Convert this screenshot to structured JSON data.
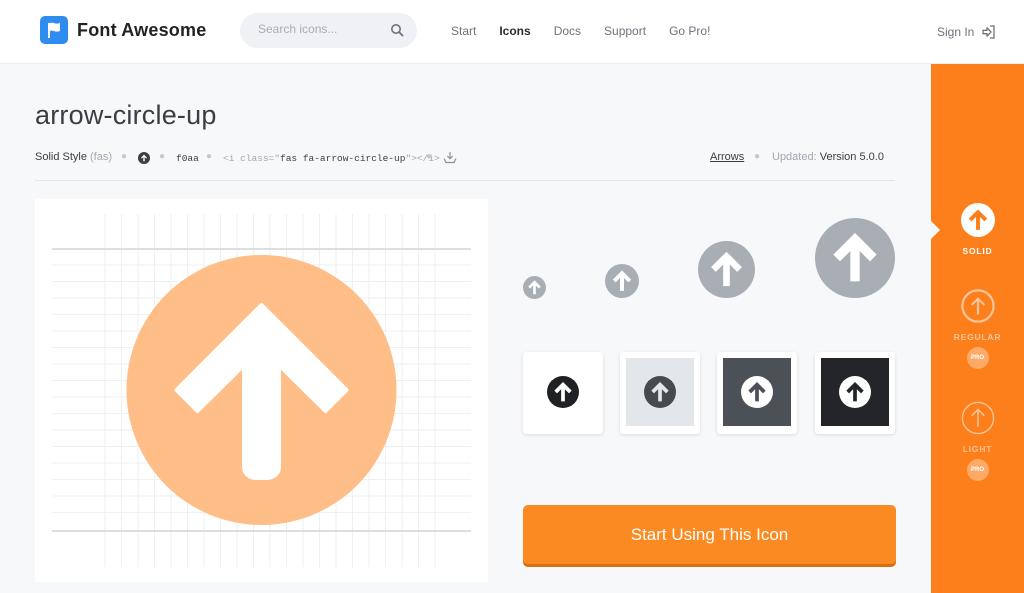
{
  "header": {
    "brand": "Font Awesome",
    "search_placeholder": "Search icons...",
    "nav": [
      "Start",
      "Icons",
      "Docs",
      "Support",
      "Go Pro!"
    ],
    "active_nav": "Icons",
    "sign_in": "Sign In"
  },
  "icon": {
    "name": "arrow-circle-up",
    "style_label": "Solid Style",
    "style_code": "(fas)",
    "unicode": "f0aa",
    "code_open": "<i class=\"",
    "code_class": "fas fa-arrow-circle-up",
    "code_close": "\"></i>",
    "category": "Arrows",
    "updated_label": "Updated:",
    "updated_version": "Version 5.0.0"
  },
  "cta_label": "Start Using This Icon",
  "styles": [
    {
      "label": "SOLID",
      "pro": false,
      "selected": true
    },
    {
      "label": "REGULAR",
      "pro": true,
      "badge": "PRO",
      "selected": false
    },
    {
      "label": "LIGHT",
      "pro": true,
      "badge": "PRO",
      "selected": false
    }
  ],
  "colors": {
    "brand_blue": "#2f8cef",
    "accent_orange": "#fd7f1b",
    "preview_orange": "#ffbd88",
    "size_gray": "#a9aeb5"
  }
}
